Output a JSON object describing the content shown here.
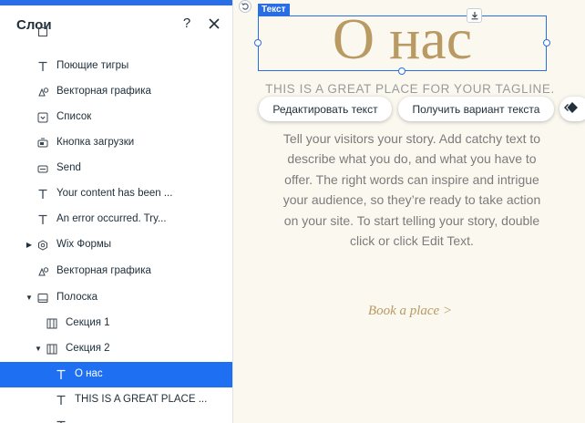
{
  "panel": {
    "title": "Слои",
    "help_label": "?",
    "close_icon": "close-icon",
    "accent_color": "#1e6ff2"
  },
  "layers": [
    {
      "label": "",
      "icon": "generic-element-icon",
      "indent": 1,
      "partial": true
    },
    {
      "label": "Поющие тигры",
      "icon": "text-icon",
      "indent": 1
    },
    {
      "label": "Векторная графика",
      "icon": "vector-art-icon",
      "indent": 1
    },
    {
      "label": "Список",
      "icon": "dropdown-list-icon",
      "indent": 1
    },
    {
      "label": "Кнопка загрузки",
      "icon": "upload-button-icon",
      "indent": 1
    },
    {
      "label": "Send",
      "icon": "button-icon",
      "indent": 1
    },
    {
      "label": "Your content has been ...",
      "icon": "text-icon",
      "indent": 1
    },
    {
      "label": "An error occurred. Try...",
      "icon": "text-icon",
      "indent": 1
    },
    {
      "label": "Wix Формы",
      "icon": "forms-icon",
      "indent": 1,
      "arrow": "right"
    },
    {
      "label": "Векторная графика",
      "icon": "vector-art-icon",
      "indent": 1
    },
    {
      "label": "Полоска",
      "icon": "strip-icon",
      "indent": 1,
      "arrow": "down"
    },
    {
      "label": "Секция 1",
      "icon": "section-icon",
      "indent": 2
    },
    {
      "label": "Секция 2",
      "icon": "section-icon",
      "indent": 2,
      "arrow": "down"
    },
    {
      "label": "О нас",
      "icon": "text-icon",
      "indent": 3,
      "selected": true
    },
    {
      "label": "THIS IS A GREAT PLACE ...",
      "icon": "text-icon",
      "indent": 3
    },
    {
      "label": "",
      "icon": "text-icon",
      "indent": 3,
      "partial": true
    }
  ],
  "canvas": {
    "element_tag": "Текст",
    "headline": "О нас",
    "tagline": "THIS IS A GREAT PLACE FOR YOUR TAGLINE.",
    "edit_text_button": "Редактировать текст",
    "get_variant_button": "Получить вариант текста",
    "body_text": "Tell your visitors your story. Add catchy text to describe what you do, and what you have to offer. The right words can inspire and intrigue your audience, so they’re ready to take action on your site. To start telling your story, double click or click Edit Text.",
    "book_link": "Book a place >",
    "accent_gold": "#b99a63",
    "selection_color": "#2a6ee6"
  }
}
